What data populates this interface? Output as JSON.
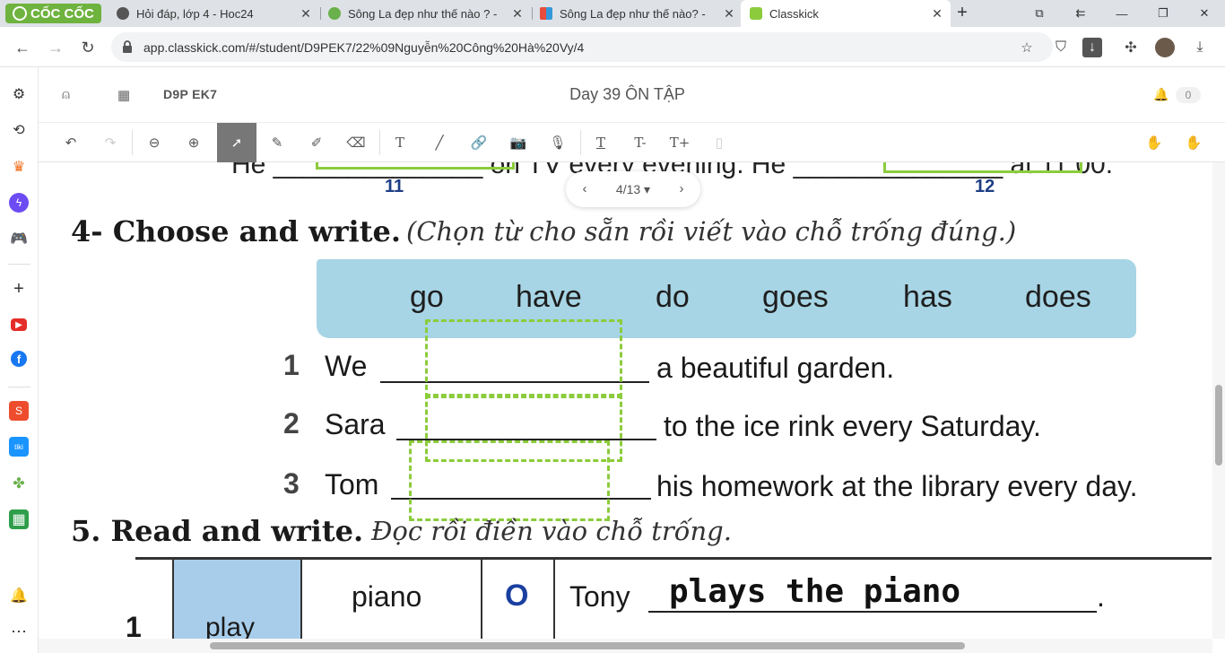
{
  "browser": {
    "brand_name": "CỐC CỐC",
    "tabs": [
      {
        "title": "Hỏi đáp, lớp 4 - Hoc24",
        "favicon": "globe-icon",
        "active": false
      },
      {
        "title": "Sông La đẹp như thế nào ? -",
        "favicon": "green-leaf-icon",
        "active": false
      },
      {
        "title": "Sông La đẹp như thế nào? -",
        "favicon": "vietjack-icon",
        "active": false
      },
      {
        "title": "Classkick",
        "favicon": "classkick-icon",
        "active": true
      }
    ],
    "new_tab_symbol": "+",
    "url": "app.classkick.com/#/student/D9PEK7/22%09Nguyễn%20Công%20Hà%20Vy/4"
  },
  "classkick": {
    "class_code": "D9P EK7",
    "assignment_title": "Day 39 ÔN TẬP",
    "notification_count": "0",
    "page_indicator": "4/13",
    "toolbar": [
      {
        "name": "undo-icon",
        "glyph": "↶"
      },
      {
        "name": "redo-icon",
        "glyph": "↷"
      },
      {
        "name": "zoom-out-icon",
        "glyph": "⊖"
      },
      {
        "name": "zoom-in-icon",
        "glyph": "⊕"
      },
      {
        "name": "select-pointer-icon",
        "glyph": "➚"
      },
      {
        "name": "pen-icon",
        "glyph": "✎"
      },
      {
        "name": "highlighter-icon",
        "glyph": "✐"
      },
      {
        "name": "eraser-icon",
        "glyph": "⌫"
      },
      {
        "name": "text-tool-icon",
        "glyph": "T"
      },
      {
        "name": "line-tool-icon",
        "glyph": "╱"
      },
      {
        "name": "link-icon",
        "glyph": "🔗"
      },
      {
        "name": "camera-icon",
        "glyph": "📷"
      },
      {
        "name": "microphone-icon",
        "glyph": "🎙"
      },
      {
        "name": "text-underline-icon",
        "glyph": "T"
      },
      {
        "name": "text-smaller-icon",
        "glyph": "T-"
      },
      {
        "name": "text-larger-icon",
        "glyph": "T+"
      },
      {
        "name": "sticker-icon",
        "glyph": "▯"
      }
    ]
  },
  "worksheet": {
    "prev_page_numbers": [
      "11",
      "12"
    ],
    "section4": {
      "title_bold": "4- Choose and write.",
      "title_italic": "(Chọn từ cho sẵn rồi viết vào chỗ trống đúng.)",
      "word_bank": [
        "go",
        "have",
        "do",
        "goes",
        "has",
        "does"
      ],
      "items": [
        {
          "num": "1",
          "start": "We",
          "end": "a beautiful garden."
        },
        {
          "num": "2",
          "start": "Sara",
          "end": "to the ice rink every Saturday."
        },
        {
          "num": "3",
          "start": "Tom",
          "end": "his homework at the library every day."
        }
      ]
    },
    "section5": {
      "title_bold": "5. Read and write.",
      "title_italic": "Đọc rồi điền vào chỗ trống.",
      "row": {
        "num": "1",
        "verb": "play",
        "object": "piano",
        "mark": "O",
        "subject": "Tony",
        "answer": "plays the piano",
        "end": "."
      }
    }
  },
  "colors": {
    "accent_green": "#8ccc3c",
    "word_bank_blue": "#a7d5e5",
    "number_blue": "#1d3e86"
  }
}
